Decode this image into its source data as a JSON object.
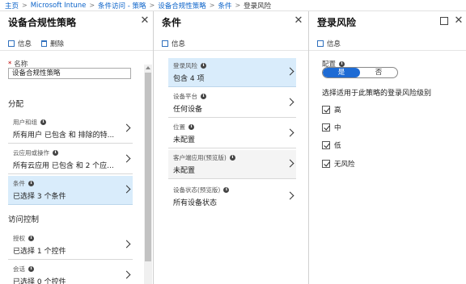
{
  "breadcrumb": {
    "items": [
      "主页",
      "Microsoft Intune",
      "条件访问 - 策略",
      "设备合规性策略",
      "条件"
    ],
    "current": "登录风险"
  },
  "blade1": {
    "title": "设备合规性策略",
    "toolbar": {
      "info_label": "信息",
      "delete_label": "删除"
    },
    "name_label": "名称",
    "name_value": "设备合规性策略",
    "assignment_heading": "分配",
    "items": [
      {
        "label": "用户和组",
        "value": "所有用户 已包含 和 排除的特..."
      },
      {
        "label": "云应用或操作",
        "value": "所有云应用 已包含 和 2 个应..."
      },
      {
        "label": "条件",
        "value": "已选择 3 个条件"
      }
    ],
    "access_heading": "访问控制",
    "access_items": [
      {
        "label": "授权",
        "value": "已选择 1 个控件"
      },
      {
        "label": "会话",
        "value": "已选择 0 个控件"
      }
    ]
  },
  "blade2": {
    "title": "条件",
    "toolbar": {
      "info_label": "信息"
    },
    "items": [
      {
        "label": "登录风险",
        "value": "包含 4 项"
      },
      {
        "label": "设备平台",
        "value": "任何设备"
      },
      {
        "label": "位置",
        "value": "未配置"
      },
      {
        "label": "客户端应用(预览版)",
        "value": "未配置"
      },
      {
        "label": "设备状态(预览版)",
        "value": "所有设备状态"
      }
    ]
  },
  "blade3": {
    "title": "登录风险",
    "toolbar": {
      "info_label": "信息"
    },
    "config_label": "配置",
    "toggle": {
      "yes": "是",
      "no": "否",
      "selected": "是"
    },
    "instruction": "选择适用于此策略的登录风险级别",
    "options": [
      {
        "label": "高",
        "checked": true
      },
      {
        "label": "中",
        "checked": true
      },
      {
        "label": "低",
        "checked": true
      },
      {
        "label": "无风险",
        "checked": true
      }
    ]
  },
  "icons": {
    "close": "✕",
    "accent": "#1e6bd4",
    "selected_bg": "#d9ecfb"
  }
}
